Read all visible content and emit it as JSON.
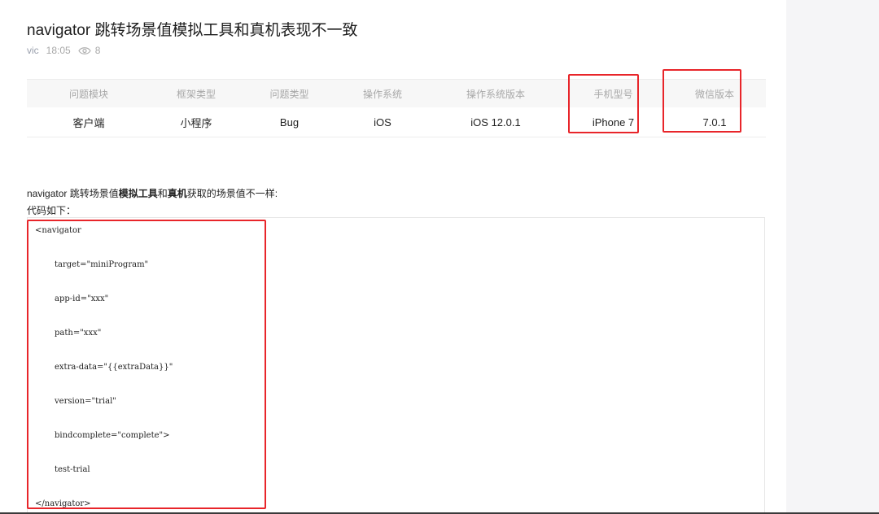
{
  "post": {
    "title": "navigator 跳转场景值模拟工具和真机表现不一致",
    "author": "vic",
    "time": "18:05",
    "views": "8"
  },
  "info_table": {
    "headers": [
      "问题模块",
      "框架类型",
      "问题类型",
      "操作系统",
      "操作系统版本",
      "手机型号",
      "微信版本"
    ],
    "values": [
      "客户端",
      "小程序",
      "Bug",
      "iOS",
      "iOS 12.0.1",
      "iPhone 7",
      "7.0.1"
    ]
  },
  "description": {
    "part1": "navigator 跳转场景值",
    "bold1": "模拟工具",
    "part2": "和",
    "bold2": "真机",
    "part3": "获取的场景值不一样:",
    "code_intro": "代码如下："
  },
  "code": {
    "lines": [
      "<navigator",
      "target=\"miniProgram\"",
      "app-id=\"xxx\"",
      "path=\"xxx\"",
      "extra-data=\"{{extraData}}\"",
      "version=\"trial\"",
      "bindcomplete=\"complete\">",
      "test-trial",
      "</navigator>"
    ]
  },
  "icons": {
    "views": "eye-icon"
  },
  "colors": {
    "highlight": "#e8252a",
    "table_header_bg": "#f7f7f7",
    "side_panel": "#f5f5f7"
  }
}
